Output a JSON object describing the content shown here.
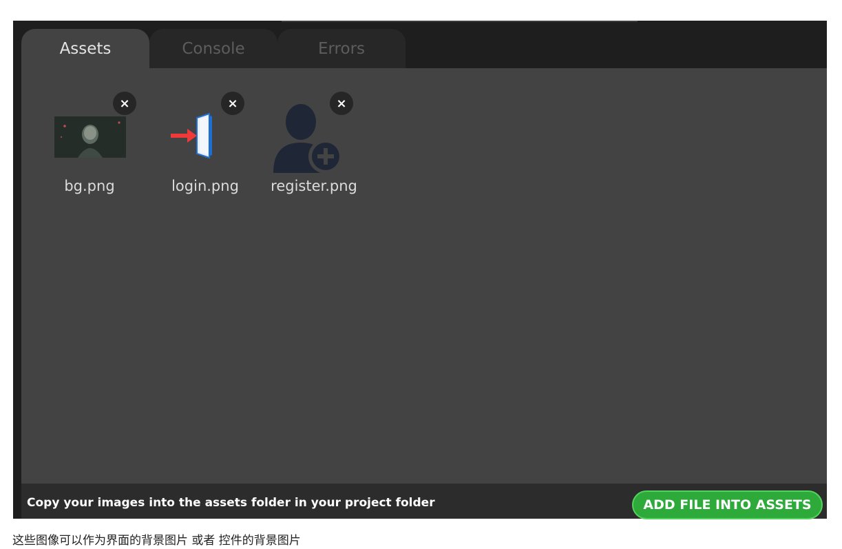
{
  "tabs": [
    {
      "label": "Assets",
      "active": true
    },
    {
      "label": "Console",
      "active": false
    },
    {
      "label": "Errors",
      "active": false
    }
  ],
  "assets": [
    {
      "name": "bg.png",
      "icon": "image-thumbnail-icon"
    },
    {
      "name": "login.png",
      "icon": "login-door-arrow-icon"
    },
    {
      "name": "register.png",
      "icon": "user-add-icon"
    }
  ],
  "close_glyph": "×",
  "footer": {
    "hint": "Copy your images into the assets folder in your project folder",
    "add_button": "ADD FILE INTO ASSETS"
  },
  "caption": "这些图像可以作为界面的背景图片 或者 控件的背景图片",
  "colors": {
    "panel_bg": "#434343",
    "tab_inactive_bg": "#272727",
    "add_button_bg": "#2eaa3b",
    "login_arrow": "#f03a3a",
    "login_door": "#1f6fd1",
    "user_icon": "#1f2636"
  }
}
